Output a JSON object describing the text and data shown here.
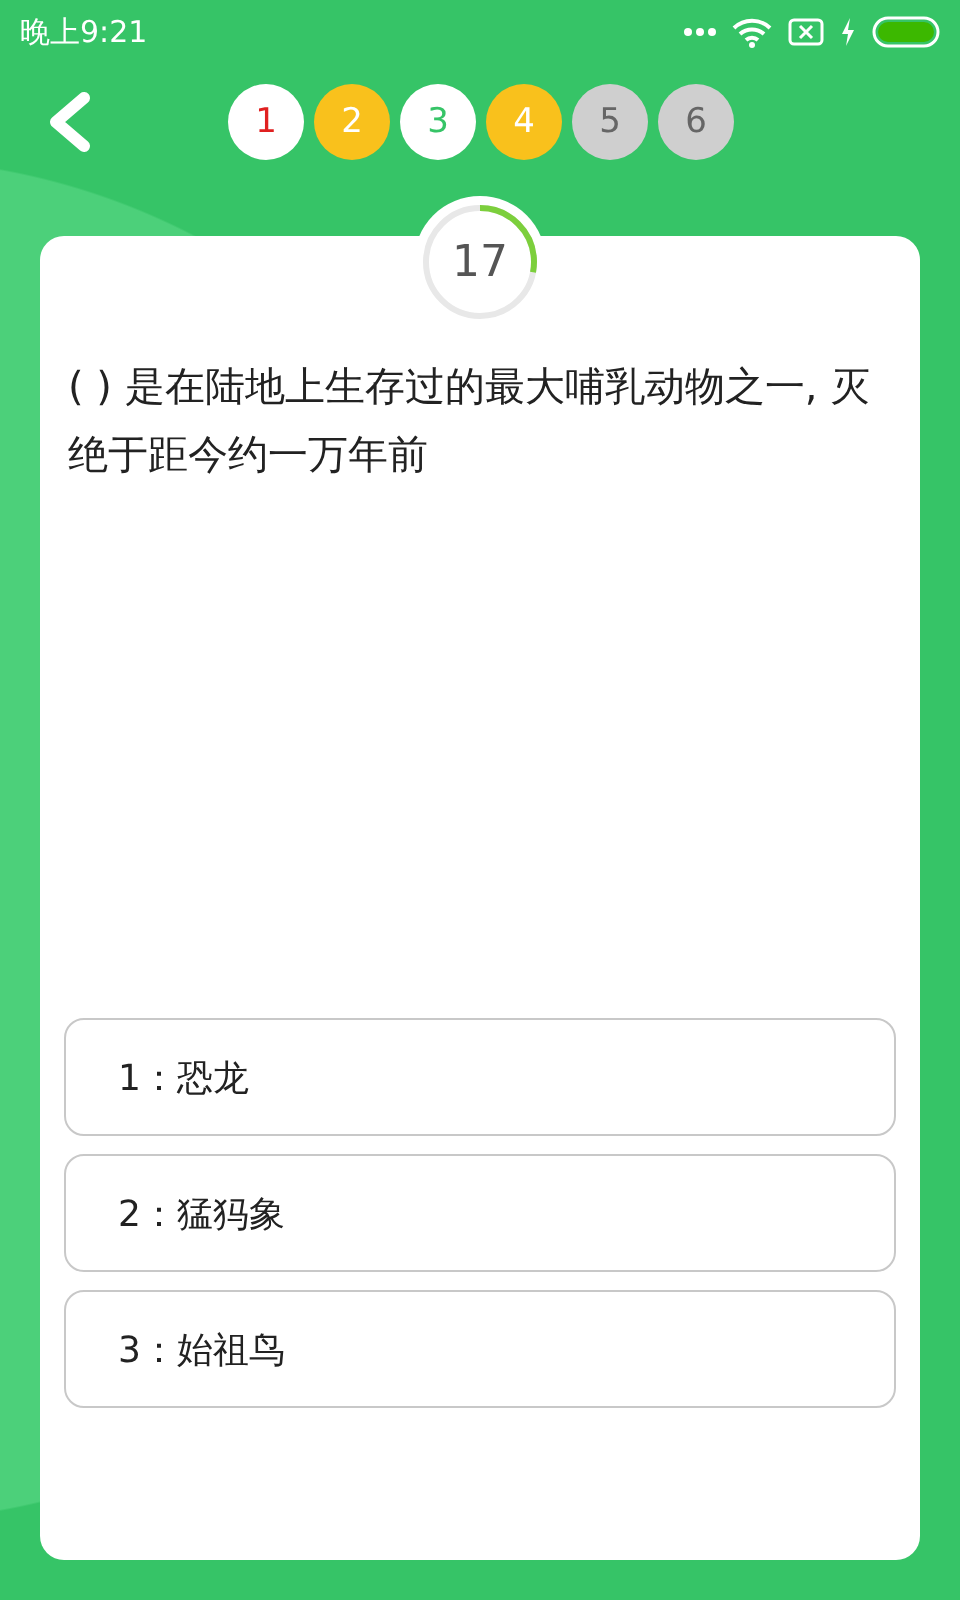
{
  "status_bar": {
    "time": "晚上9:21"
  },
  "question_nav": [
    {
      "label": "1",
      "kind": "wrong"
    },
    {
      "label": "2",
      "kind": "answered"
    },
    {
      "label": "3",
      "kind": "correct"
    },
    {
      "label": "4",
      "kind": "answered"
    },
    {
      "label": "5",
      "kind": "pending"
    },
    {
      "label": "6",
      "kind": "pending"
    }
  ],
  "timer": {
    "value": "17",
    "level": 0.28
  },
  "question": "( ) 是在陆地上生存过的最大哺乳动物之一, 灭绝于距今约一万年前",
  "options": [
    {
      "label": "1：恐龙"
    },
    {
      "label": "2：猛犸象"
    },
    {
      "label": "3：始祖鸟"
    }
  ]
}
